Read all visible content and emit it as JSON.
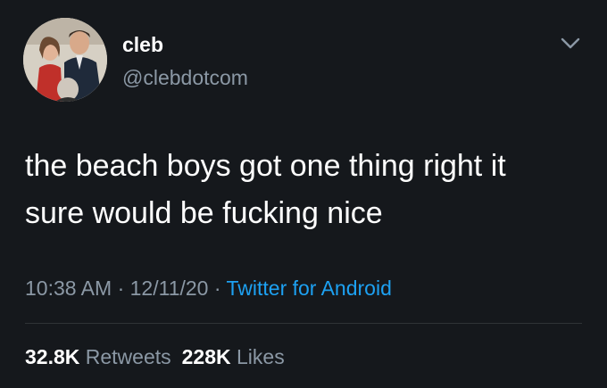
{
  "user": {
    "display_name": "cleb",
    "handle": "@clebdotcom"
  },
  "tweet": {
    "text_line1": "the beach boys got one thing right it",
    "text_line2": "sure would be fucking nice"
  },
  "meta": {
    "time": "10:38 AM",
    "separator": " · ",
    "date": "12/11/20",
    "source": "Twitter for Android"
  },
  "stats": {
    "retweets_count": "32.8K",
    "retweets_label": "Retweets",
    "likes_count": "228K",
    "likes_label": "Likes"
  },
  "colors": {
    "background": "#15181c",
    "text": "#ffffff",
    "secondary": "#8b98a5",
    "link": "#1da1f2"
  },
  "icons": {
    "menu": "chevron-down-icon"
  }
}
